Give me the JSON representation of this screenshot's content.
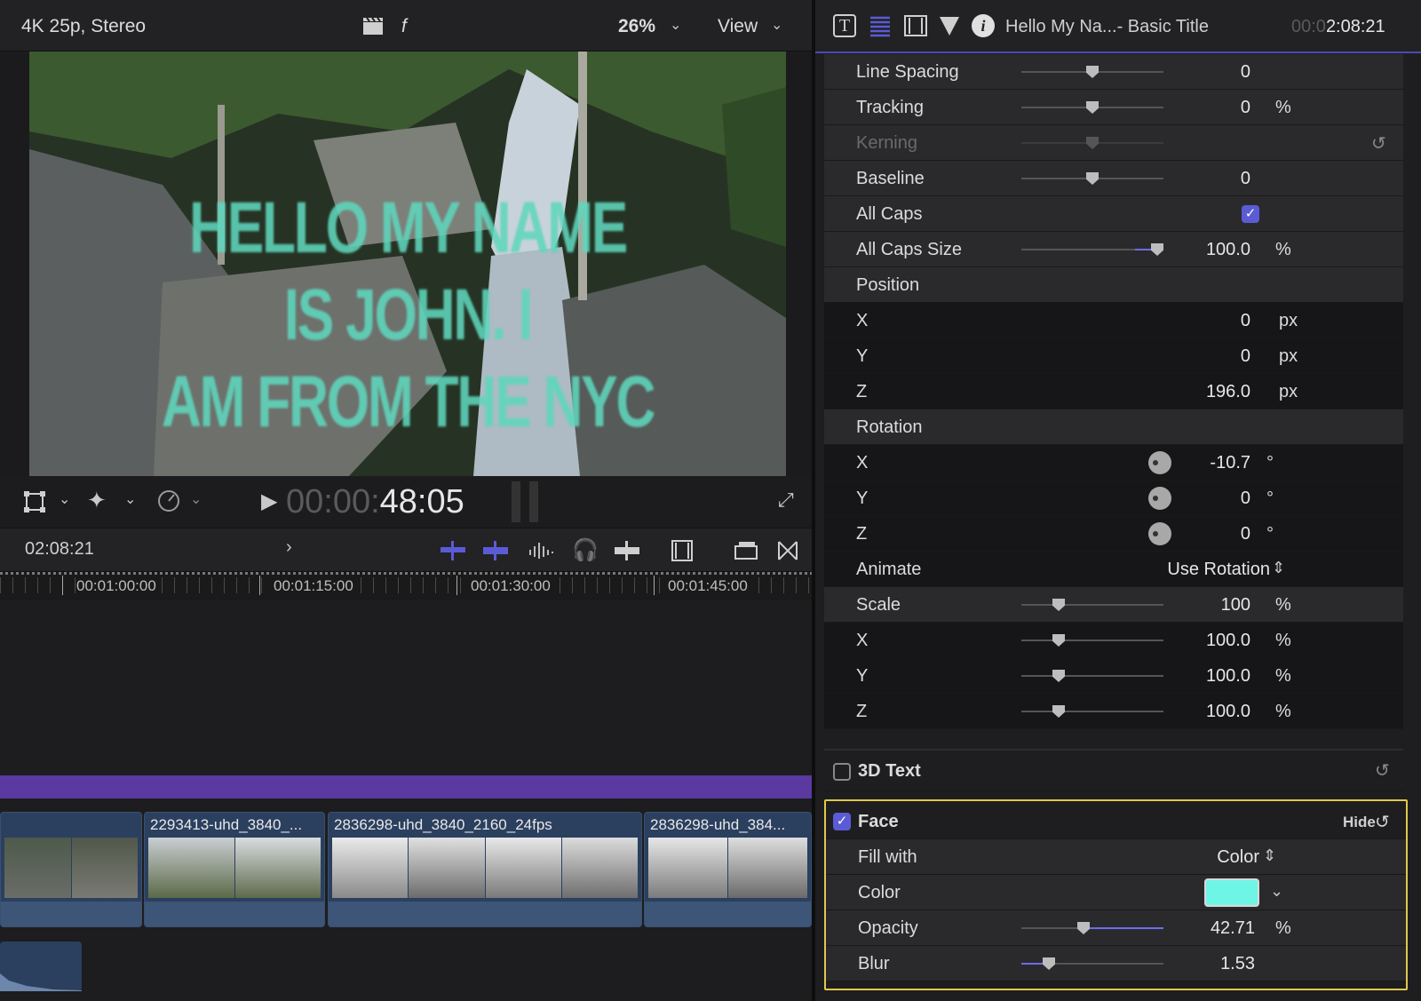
{
  "viewer": {
    "format": "4K 25p, Stereo",
    "clapper_icon": "clapper-icon",
    "f_label": "f",
    "zoom": "26%",
    "view_label": "View",
    "title_lines": [
      "HELLO MY NAME",
      "IS JOHN. I",
      "AM FROM THE NYC"
    ],
    "title_color": "#5fd6bc",
    "timecode_dim": "00:00:",
    "timecode_bright": "48:05"
  },
  "timeline": {
    "duration": "02:08:21",
    "ruler_labels": [
      "00:01:00:00",
      "00:01:15:00",
      "00:01:30:00",
      "00:01:45:00"
    ],
    "clips": [
      {
        "name": ""
      },
      {
        "name": "2293413-uhd_3840_..."
      },
      {
        "name": "2836298-uhd_3840_2160_24fps"
      },
      {
        "name": "2836298-uhd_384..."
      }
    ]
  },
  "inspector": {
    "header_title": "Hello My Na...- Basic Title",
    "timecode_dim": "00:0",
    "timecode_bright": "2:08:21",
    "rows": {
      "line_spacing": {
        "label": "Line Spacing",
        "value": "0"
      },
      "tracking": {
        "label": "Tracking",
        "value": "0",
        "unit": "%"
      },
      "kerning": {
        "label": "Kerning"
      },
      "baseline": {
        "label": "Baseline",
        "value": "0"
      },
      "all_caps": {
        "label": "All Caps",
        "checked": true
      },
      "all_caps_size": {
        "label": "All Caps Size",
        "value": "100.0",
        "unit": "%"
      },
      "position": {
        "label": "Position"
      },
      "pos_x": {
        "label": "X",
        "value": "0",
        "unit": "px"
      },
      "pos_y": {
        "label": "Y",
        "value": "0",
        "unit": "px"
      },
      "pos_z": {
        "label": "Z",
        "value": "196.0",
        "unit": "px"
      },
      "rotation": {
        "label": "Rotation"
      },
      "rot_x": {
        "label": "X",
        "value": "-10.7",
        "unit": "°"
      },
      "rot_y": {
        "label": "Y",
        "value": "0",
        "unit": "°"
      },
      "rot_z": {
        "label": "Z",
        "value": "0",
        "unit": "°"
      },
      "animate": {
        "label": "Animate",
        "value": "Use Rotation"
      },
      "scale": {
        "label": "Scale",
        "value": "100",
        "unit": "%"
      },
      "scale_x": {
        "label": "X",
        "value": "100.0",
        "unit": "%"
      },
      "scale_y": {
        "label": "Y",
        "value": "100.0",
        "unit": "%"
      },
      "scale_z": {
        "label": "Z",
        "value": "100.0",
        "unit": "%"
      },
      "text_3d": {
        "label": "3D Text",
        "checked": false
      },
      "face": {
        "label": "Face",
        "checked": true,
        "hide_label": "Hide"
      },
      "fill_with": {
        "label": "Fill with",
        "value": "Color"
      },
      "color": {
        "label": "Color",
        "swatch": "#6ff5e6"
      },
      "opacity": {
        "label": "Opacity",
        "value": "42.71",
        "unit": "%"
      },
      "blur": {
        "label": "Blur",
        "value": "1.53"
      }
    }
  },
  "colors": {
    "accent": "#5b5bd6",
    "highlight": "#e0c84a",
    "timeline_band": "#5a3aa0"
  }
}
